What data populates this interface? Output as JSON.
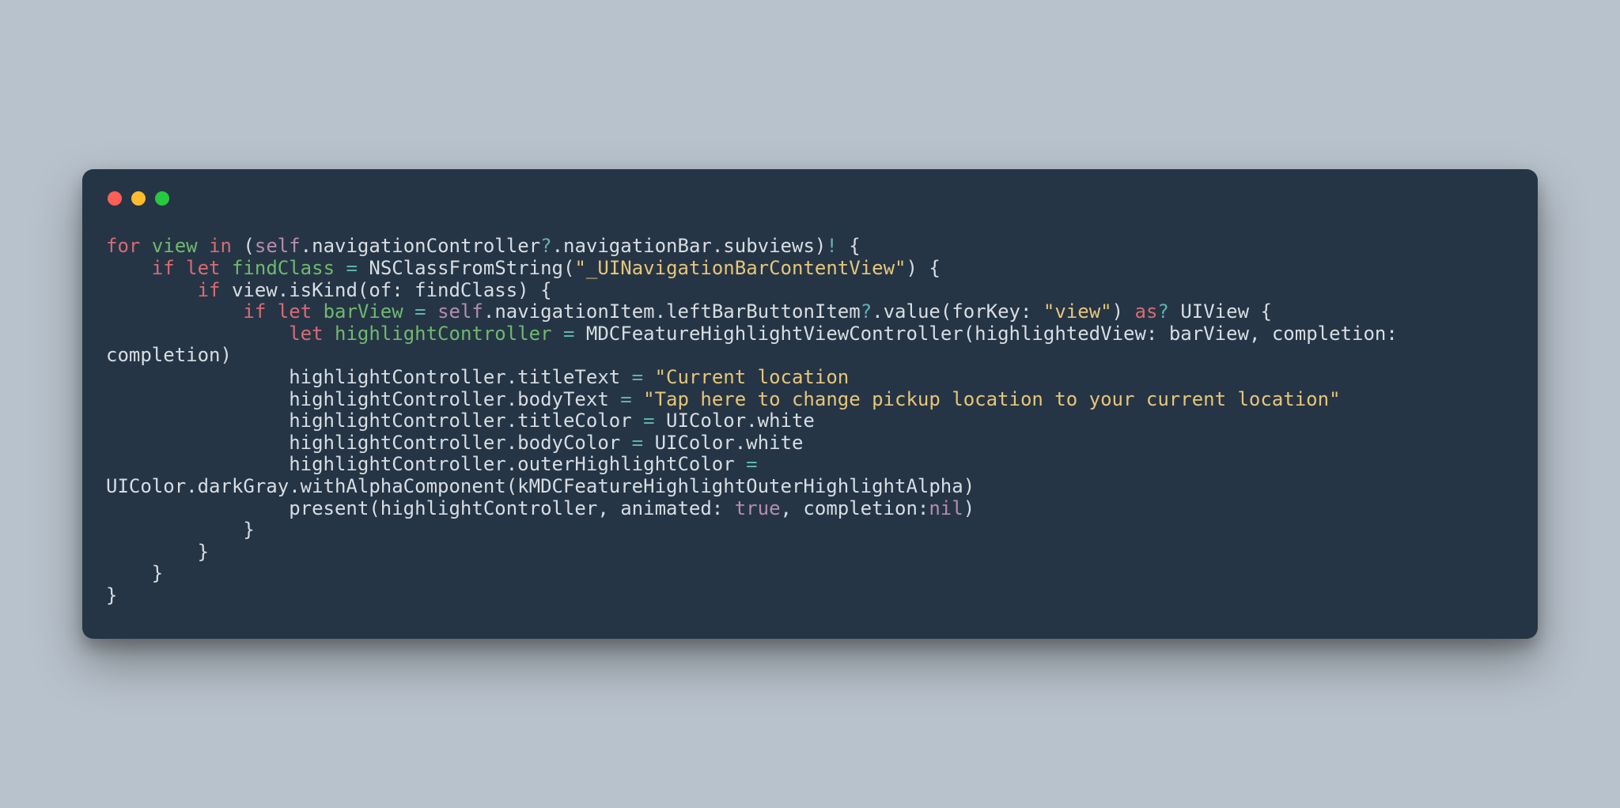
{
  "colors": {
    "page_bg": "#b8c2cc",
    "window_bg": "#263545",
    "text": "#d7dde3",
    "keyword": "#d86b74",
    "identifier": "#6fb96f",
    "literal": "#b48ead",
    "string": "#e6c67a",
    "operator": "#5fb3b3",
    "traffic_red": "#ff5f56",
    "traffic_yellow": "#ffbd2e",
    "traffic_green": "#27c93f"
  },
  "code": {
    "tokens": [
      [
        [
          "kw",
          "for"
        ],
        [
          "sp",
          " "
        ],
        [
          "id",
          "view"
        ],
        [
          "sp",
          " "
        ],
        [
          "kw",
          "in"
        ],
        [
          "sp",
          " ("
        ],
        [
          "self",
          "self"
        ],
        [
          "t",
          ".navigationController"
        ],
        [
          "op",
          "?"
        ],
        [
          "t",
          ".navigationBar.subviews)"
        ],
        [
          "op",
          "!"
        ],
        [
          "t",
          " {"
        ]
      ],
      [
        [
          "sp",
          "    "
        ],
        [
          "kw",
          "if"
        ],
        [
          "sp",
          " "
        ],
        [
          "kw",
          "let"
        ],
        [
          "sp",
          " "
        ],
        [
          "id",
          "findClass"
        ],
        [
          "sp",
          " "
        ],
        [
          "op",
          "="
        ],
        [
          "sp",
          " NSClassFromString("
        ],
        [
          "str",
          "\"_UINavigationBarContentView\""
        ],
        [
          "t",
          ") {"
        ]
      ],
      [
        [
          "sp",
          "        "
        ],
        [
          "kw",
          "if"
        ],
        [
          "sp",
          " view.isKind(of: findClass) {"
        ]
      ],
      [
        [
          "sp",
          "            "
        ],
        [
          "kw",
          "if"
        ],
        [
          "sp",
          " "
        ],
        [
          "kw",
          "let"
        ],
        [
          "sp",
          " "
        ],
        [
          "id",
          "barView"
        ],
        [
          "sp",
          " "
        ],
        [
          "op",
          "="
        ],
        [
          "sp",
          " "
        ],
        [
          "self",
          "self"
        ],
        [
          "t",
          ".navigationItem.leftBarButtonItem"
        ],
        [
          "op",
          "?"
        ],
        [
          "t",
          ".value(forKey: "
        ],
        [
          "str",
          "\"view\""
        ],
        [
          "t",
          ") "
        ],
        [
          "kw",
          "as"
        ],
        [
          "op",
          "?"
        ],
        [
          "t",
          " UIView {"
        ]
      ],
      [
        [
          "sp",
          "                "
        ],
        [
          "kw",
          "let"
        ],
        [
          "sp",
          " "
        ],
        [
          "id",
          "highlightController"
        ],
        [
          "sp",
          " "
        ],
        [
          "op",
          "="
        ],
        [
          "sp",
          " MDCFeatureHighlightViewController(highlightedView: barView, completion: completion)"
        ]
      ],
      [
        [
          "sp",
          "                highlightController.titleText "
        ],
        [
          "op",
          "="
        ],
        [
          "sp",
          " "
        ],
        [
          "str",
          "\"Current location"
        ]
      ],
      [
        [
          "sp",
          "                highlightController.bodyText "
        ],
        [
          "op",
          "="
        ],
        [
          "sp",
          " "
        ],
        [
          "str",
          "\"Tap here to change pickup location to your current location\""
        ]
      ],
      [
        [
          "sp",
          "                highlightController.titleColor "
        ],
        [
          "op",
          "="
        ],
        [
          "t",
          " UIColor.white"
        ]
      ],
      [
        [
          "sp",
          "                highlightController.bodyColor "
        ],
        [
          "op",
          "="
        ],
        [
          "t",
          " UIColor.white"
        ]
      ],
      [
        [
          "sp",
          "                highlightController.outerHighlightColor "
        ],
        [
          "op",
          "="
        ],
        [
          "t",
          " UIColor.darkGray.withAlphaComponent(kMDCFeatureHighlightOuterHighlightAlpha)"
        ]
      ],
      [
        [
          "sp",
          "                present(highlightController, animated: "
        ],
        [
          "self",
          "true"
        ],
        [
          "t",
          ", completion:"
        ],
        [
          "self",
          "nil"
        ],
        [
          "t",
          ")"
        ]
      ],
      [
        [
          "t",
          "            }"
        ]
      ],
      [
        [
          "t",
          "        }"
        ]
      ],
      [
        [
          "t",
          "    }"
        ]
      ],
      [
        [
          "t",
          "}"
        ]
      ]
    ],
    "raw": "for view in (self.navigationController?.navigationBar.subviews)! {\n    if let findClass = NSClassFromString(\"_UINavigationBarContentView\") {\n        if view.isKind(of: findClass) {\n            if let barView = self.navigationItem.leftBarButtonItem?.value(forKey: \"view\") as? UIView {\n                let highlightController = MDCFeatureHighlightViewController(highlightedView: barView, completion: completion)\n                highlightController.titleText = \"Current location\n                highlightController.bodyText = \"Tap here to change pickup location to your current location\"\n                highlightController.titleColor = UIColor.white\n                highlightController.bodyColor = UIColor.white\n                highlightController.outerHighlightColor = UIColor.darkGray.withAlphaComponent(kMDCFeatureHighlightOuterHighlightAlpha)\n                present(highlightController, animated: true, completion:nil)\n            }\n        }\n    }\n}"
  }
}
